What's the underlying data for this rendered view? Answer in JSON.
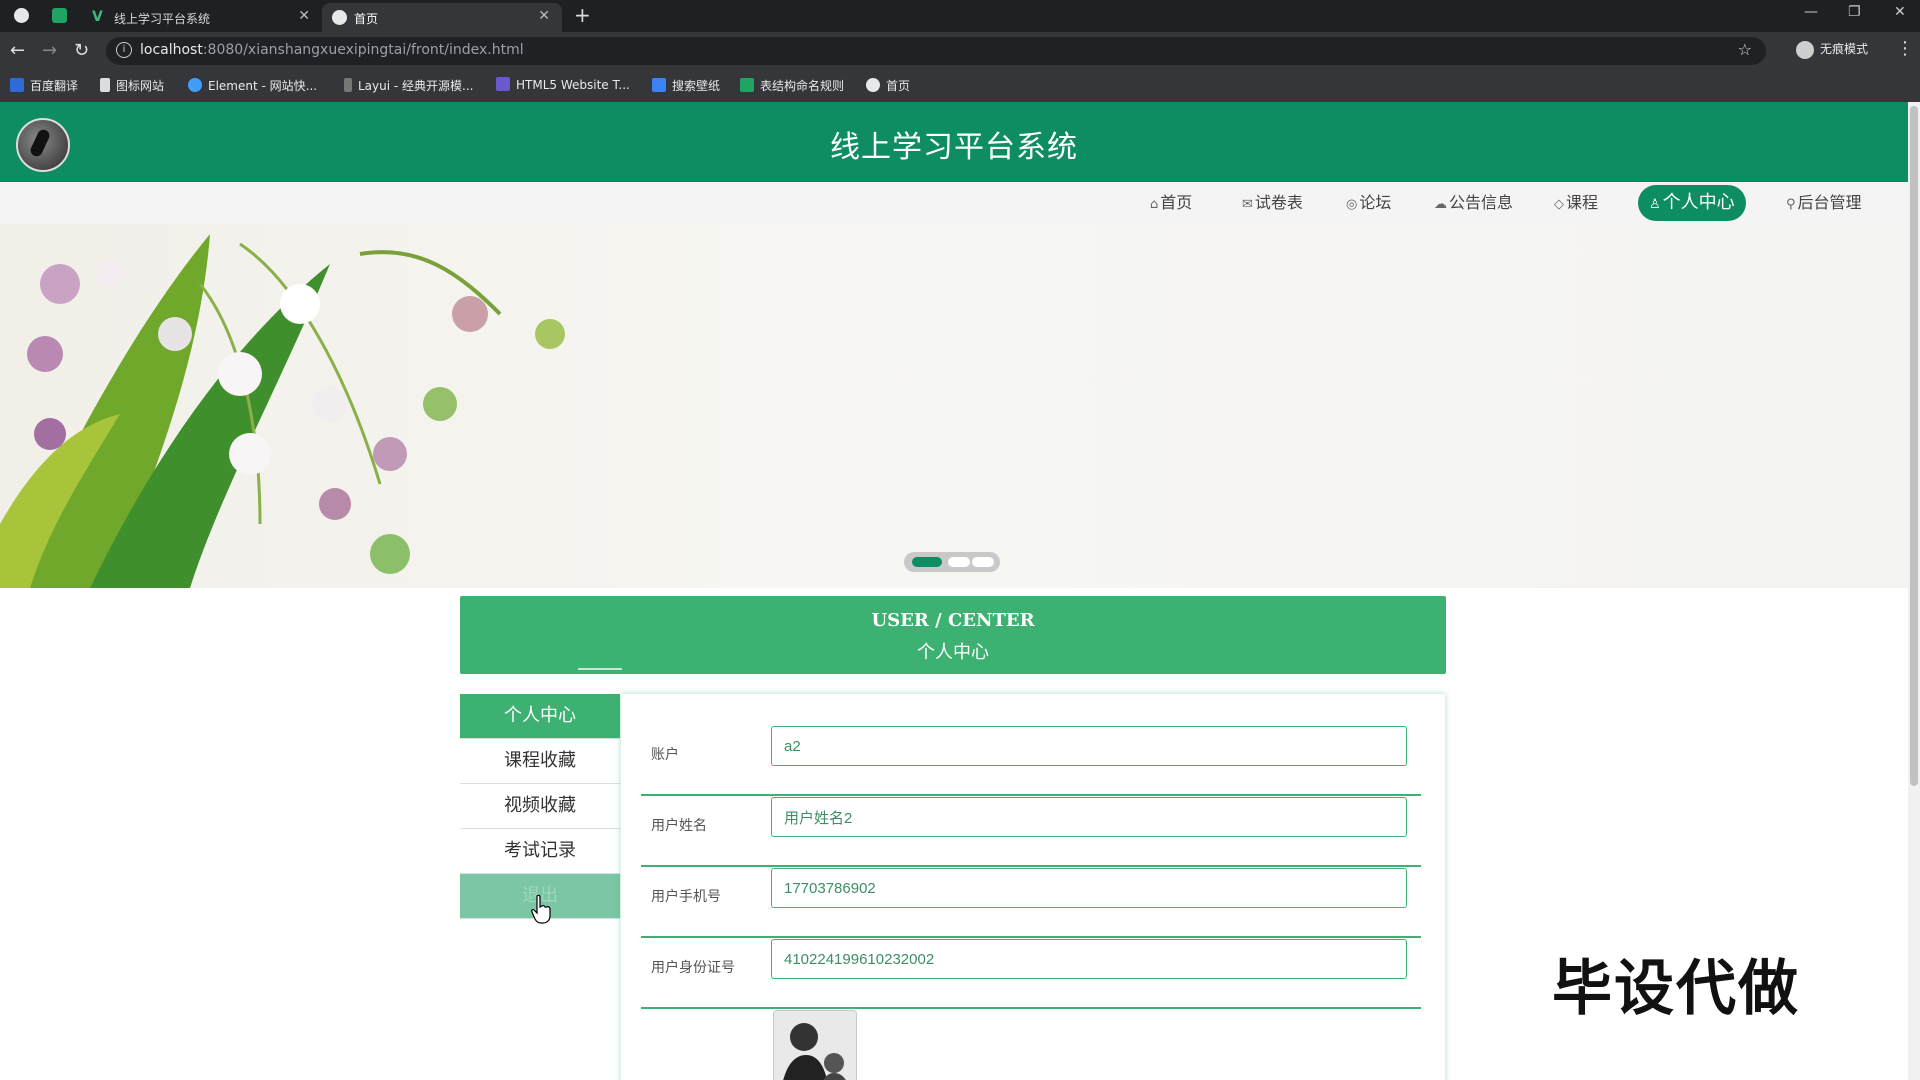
{
  "browser": {
    "tabs": [
      {
        "label": "线上学习平台系统",
        "active": false
      },
      {
        "label": "首页",
        "active": true
      }
    ],
    "url_host": "localhost",
    "url_path": ":8080/xianshangxuexipingtai/front/index.html",
    "incognito_label": "无痕模式",
    "bookmarks": [
      "百度翻译",
      "图标网站",
      "Element - 网站快...",
      "Layui - 经典开源模...",
      "HTML5 Website T...",
      "搜索壁纸",
      "表结构命名规则",
      "首页"
    ]
  },
  "site": {
    "title": "线上学习平台系统",
    "nav": [
      {
        "label": "首页",
        "icon": "home-icon",
        "glyph": "⌂"
      },
      {
        "label": "试卷表",
        "icon": "mail-icon",
        "glyph": "✉"
      },
      {
        "label": "论坛",
        "icon": "globe-icon",
        "glyph": "◎"
      },
      {
        "label": "公告信息",
        "icon": "cloud-icon",
        "glyph": "☁"
      },
      {
        "label": "课程",
        "icon": "tag-icon",
        "glyph": "◇"
      },
      {
        "label": "个人中心",
        "icon": "user-icon",
        "glyph": "♙",
        "active": true
      },
      {
        "label": "后台管理",
        "icon": "link-icon",
        "glyph": "⚲"
      }
    ],
    "carousel": {
      "slides": 3,
      "active_index": 0
    }
  },
  "user_center": {
    "title_en": "USER / CENTER",
    "title_cn": "个人中心",
    "menu": [
      "个人中心",
      "课程收藏",
      "视频收藏",
      "考试记录",
      "退出"
    ],
    "active_menu_index": 0,
    "fields": [
      {
        "label": "账户",
        "value": "a2"
      },
      {
        "label": "用户姓名",
        "value": "用户姓名2"
      },
      {
        "label": "用户手机号",
        "value": "17703786902"
      },
      {
        "label": "用户身份证号",
        "value": "410224199610232002"
      }
    ]
  },
  "watermark": "毕设代做",
  "colors": {
    "primary": "#0e8d63",
    "accent": "#3db172"
  }
}
